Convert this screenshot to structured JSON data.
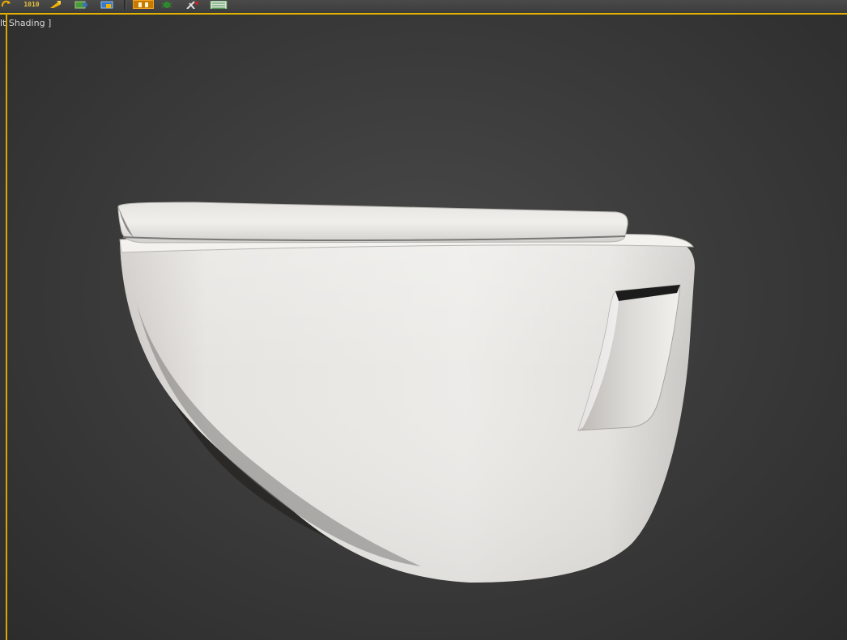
{
  "viewport": {
    "label": "lt Shading ]",
    "active_border_color": "#e3b200",
    "background_color": "#3c3c3c"
  },
  "toolbar": {
    "icons": [
      "refresh-icon",
      "binary-1010-icon",
      "arrow-icon",
      "render-setup-icon",
      "render-frame-icon",
      "separator",
      "material-editor-icon",
      "bug-icon",
      "tools-icon",
      "list-icon"
    ],
    "binary_label": "1010"
  },
  "model": {
    "object": "wall-hung-toilet",
    "color": "#e8e6e3"
  }
}
